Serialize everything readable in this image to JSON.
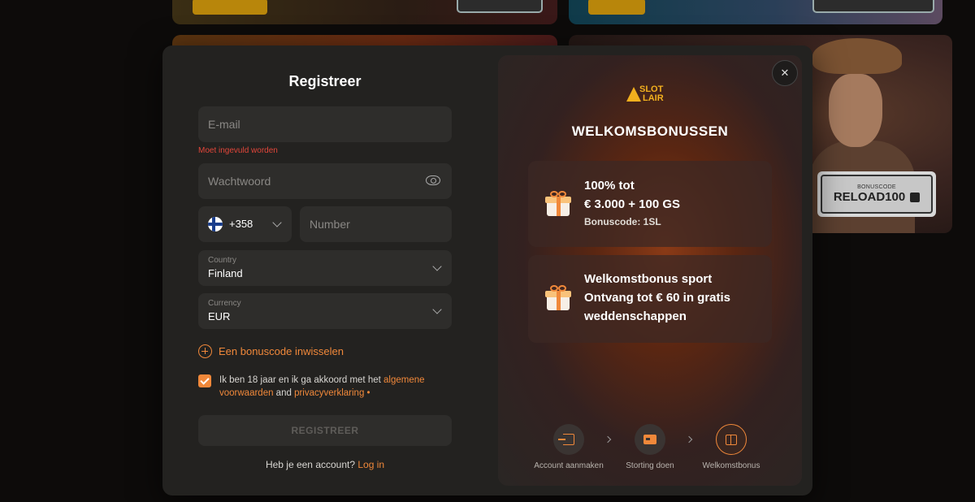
{
  "background": {
    "bonus_box_label": "BONUSCODE",
    "bonus_box_code": "RELOAD100"
  },
  "form": {
    "title": "Registreer",
    "email_placeholder": "E-mail",
    "email_error": "Moet ingevuld worden",
    "password_placeholder": "Wachtwoord",
    "phone_dial_code": "+358",
    "phone_placeholder": "Number",
    "country_label": "Country",
    "country_value": "Finland",
    "currency_label": "Currency",
    "currency_value": "EUR",
    "bonus_code_link": "Een bonuscode inwisselen",
    "agree_text_1": "Ik ben 18 jaar en ik ga akkoord met het ",
    "agree_link_terms": "algemene voorwaarden",
    "agree_text_2": " and ",
    "agree_link_privacy": "privacyverklaring",
    "agree_required_mark": " •",
    "agree_checked": true,
    "submit_label": "REGISTREER",
    "login_prompt": "Heb je een account? ",
    "login_link": "Log in"
  },
  "promo": {
    "close_label": "✕",
    "logo_line1": "SLOT",
    "logo_line2": "LAIR",
    "title": "WELKOMSBONUSSEN",
    "offers": [
      {
        "line1": "100% tot",
        "line2": "€ 3.000 + 100 GS",
        "code": "Bonuscode: 1SL"
      },
      {
        "line1": "Welkomstbonus sport",
        "line2": "Ontvang tot € 60 in gratis",
        "line3": "weddenschappen"
      }
    ],
    "steps": [
      {
        "label": "Account aanmaken",
        "icon": "login-icon"
      },
      {
        "label": "Storting doen",
        "icon": "card-icon"
      },
      {
        "label": "Welkomstbonus",
        "icon": "gift-icon"
      }
    ]
  },
  "colors": {
    "accent": "#f0883a",
    "error": "#e2463a",
    "modal_bg": "#232220",
    "field_bg": "#2e2d2b"
  }
}
